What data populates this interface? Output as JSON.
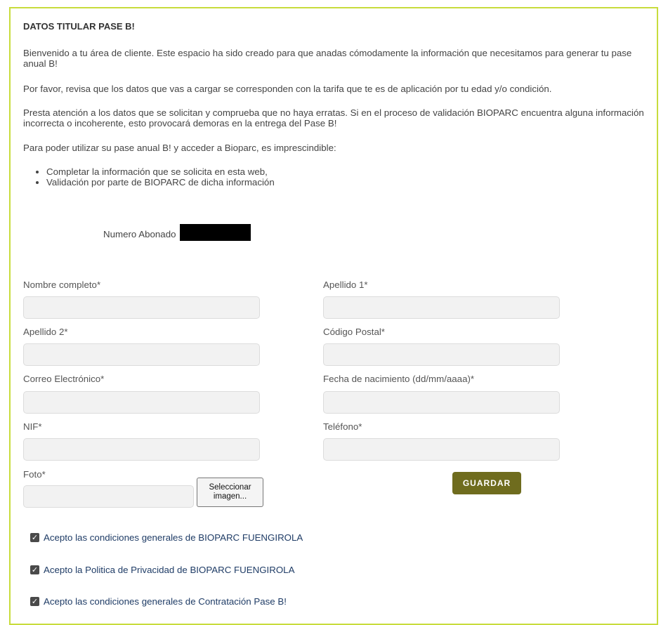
{
  "header": {
    "title": "DATOS TITULAR PASE B!"
  },
  "intro": {
    "p1": "Bienvenido a tu área de cliente. Este espacio ha sido creado para que anadas cómodamente la información que necesitamos para generar tu pase anual B!",
    "p2": "Por favor, revisa que los datos que vas a cargar se corresponden con la tarifa que te es de aplicación por tu edad y/o condición.",
    "p3": "Presta atención a los datos que se solicitan y comprueba que no haya erratas. Si en el proceso de validación BIOPARC encuentra alguna información incorrecta o incoherente, esto provocará demoras en la entrega del Pase B!",
    "p4": "Para poder utilizar su pase anual B! y acceder a Bioparc, es imprescindible:",
    "bullets": [
      "Completar la información que se solicita en esta web,",
      "Validación por parte de BIOPARC de dicha información"
    ]
  },
  "abonado": {
    "label": "Numero Abonado"
  },
  "form": {
    "nombre_label": "Nombre completo*",
    "apellido1_label": "Apellido 1*",
    "apellido2_label": "Apellido 2*",
    "cp_label": "Código Postal*",
    "email_label": "Correo Electrónico*",
    "fecha_label": "Fecha de nacimiento (dd/mm/aaaa)*",
    "nif_label": "NIF*",
    "telefono_label": "Teléfono*",
    "foto_label": "Foto*",
    "select_image_label": "Seleccionar imagen...",
    "save_label": "GUARDAR"
  },
  "consents": [
    {
      "label": "Acepto las condiciones generales de BIOPARC FUENGIROLA",
      "checked": true
    },
    {
      "label": "Acepto la Politica de Privacidad de BIOPARC FUENGIROLA",
      "checked": true
    },
    {
      "label": "Acepto las condiciones generales de Contratación Pase B!",
      "checked": true
    }
  ],
  "colors": {
    "border_accent": "#c8dc3c",
    "button_bg": "#6f6c1e",
    "link_text": "#1f3c66"
  }
}
